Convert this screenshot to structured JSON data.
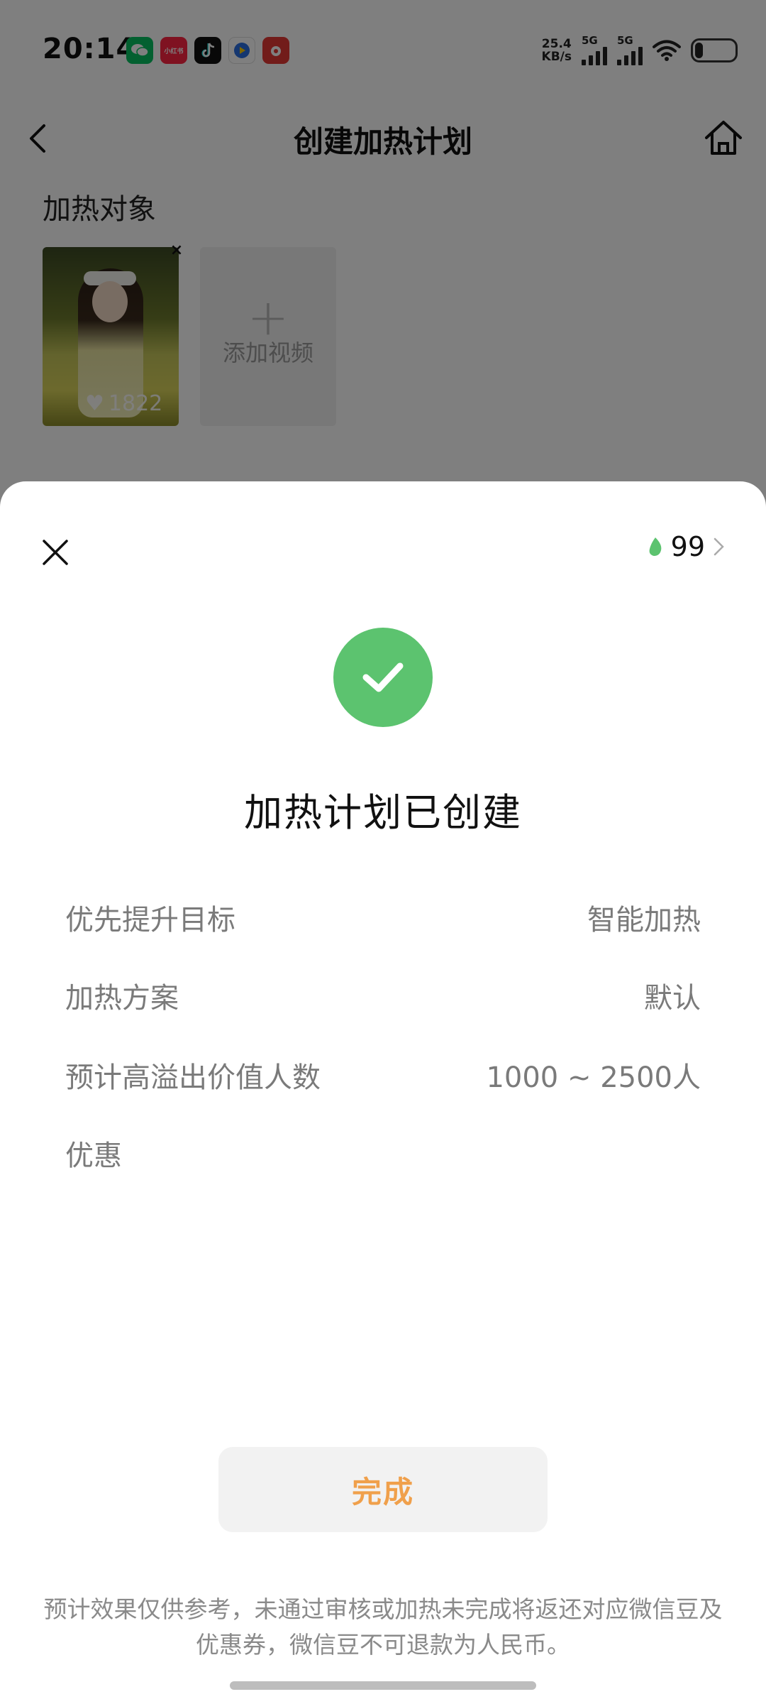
{
  "status_bar": {
    "time": "20:14",
    "apps": [
      {
        "name": "wechat-app-icon",
        "color": "#07c160",
        "label": ""
      },
      {
        "name": "xiaohongshu-app-icon",
        "color": "#ff2442",
        "label": "小红书"
      },
      {
        "name": "tiktok-app-icon",
        "color": "#111111",
        "label": ""
      },
      {
        "name": "video-app-icon",
        "color": "#2b6fe0",
        "label": ""
      },
      {
        "name": "news-app-icon",
        "color": "#e53935",
        "label": ""
      }
    ],
    "net_speed_value": "25.4",
    "net_speed_unit": "KB/s",
    "signal1_label": "5G",
    "signal2_label": "5G"
  },
  "nav": {
    "title": "创建加热计划"
  },
  "target": {
    "section_label": "加热对象",
    "video_likes": "1822",
    "add_video_label": "添加视频"
  },
  "sheet": {
    "bean_count": "99",
    "bean_color": "#5cc36f",
    "success_title": "加热计划已创建",
    "rows": [
      {
        "label": "优先提升目标",
        "value": "智能加热"
      },
      {
        "label": "加热方案",
        "value": "默认"
      },
      {
        "label": "预计高溢出价值人数",
        "value": "1000 ~ 2500人"
      },
      {
        "label": "优惠",
        "value": ""
      }
    ],
    "done_label": "完成",
    "done_color": "#f0a04b",
    "note": "预计效果仅供参考，未通过审核或加热未完成将返还对应微信豆及优惠券，微信豆不可退款为人民币。"
  }
}
